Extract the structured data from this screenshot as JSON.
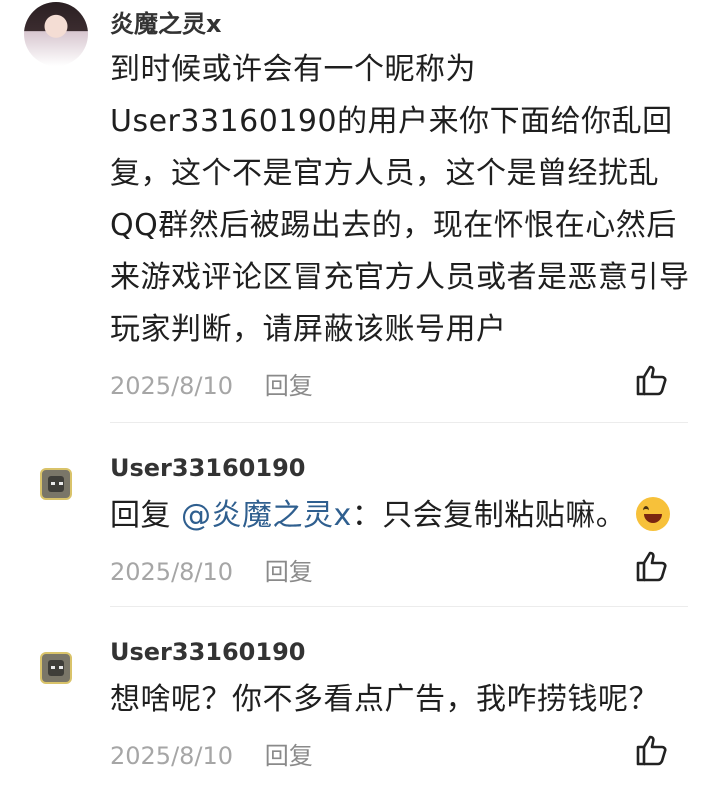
{
  "comments": [
    {
      "username": "炎魔之灵x",
      "content": "到时候或许会有一个昵称为User33160190的用户来你下面给你乱回复，这个不是官方人员，这个是曾经扰乱QQ群然后被踢出去的，现在怀恨在心然后来游戏评论区冒充官方人员或者是恶意引导玩家判断，请屏蔽该账号用户",
      "date": "2025/8/10",
      "reply_label": "回复"
    },
    {
      "username": "User33160190",
      "reply_prefix": "回复 ",
      "mention": "@炎魔之灵x",
      "content": "：只会复制粘贴嘛。",
      "emoji": "grinning-face-emoji",
      "date": "2025/8/10",
      "reply_label": "回复"
    },
    {
      "username": "User33160190",
      "content": "想啥呢？你不多看点广告，我咋捞钱呢？",
      "date": "2025/8/10",
      "reply_label": "回复"
    }
  ],
  "icons": {
    "like": "thumbs-up-icon"
  },
  "colors": {
    "mention": "#2f5f8f",
    "meta": "#a6a6a6"
  }
}
